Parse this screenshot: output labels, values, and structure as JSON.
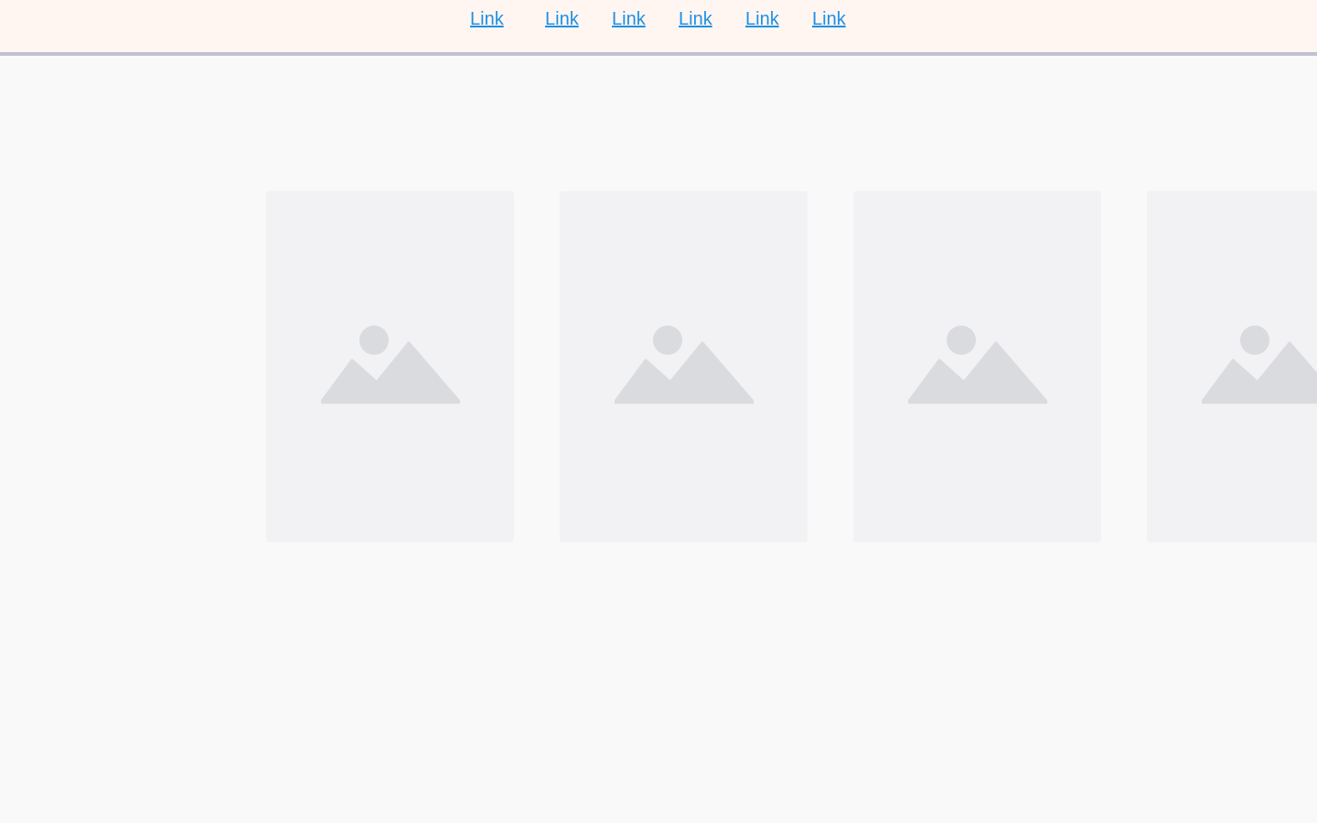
{
  "nav": {
    "links": [
      "Link",
      "Link",
      "Link",
      "Link",
      "Link",
      "Link"
    ]
  },
  "carousel": {
    "cards": [
      {
        "icon": "image-placeholder-icon"
      },
      {
        "icon": "image-placeholder-icon"
      },
      {
        "icon": "image-placeholder-icon"
      },
      {
        "icon": "image-placeholder-icon"
      }
    ]
  },
  "colors": {
    "link": "#1e90e6",
    "nav_background": "#fff6f1",
    "nav_border": "#c0c2d0",
    "page_background": "#f9f9f9",
    "card_background": "#f2f2f4",
    "placeholder_icon": "#dadbde"
  }
}
